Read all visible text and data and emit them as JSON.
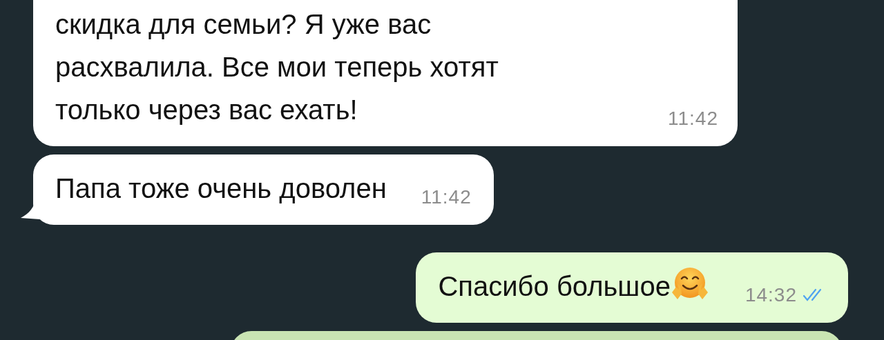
{
  "messages": [
    {
      "kind": "incoming",
      "text": "скидка для семьи? Я уже вас\nрасхвалила. Все мои теперь хотят\nтолько через вас ехать!",
      "time": "11:42",
      "tail": false,
      "cut_top": true
    },
    {
      "kind": "incoming",
      "text": "Папа тоже очень доволен",
      "time": "11:42",
      "tail": true,
      "cut_top": false
    },
    {
      "kind": "outgoing",
      "text": "Спасибо большое",
      "emoji": true,
      "time": "14:32",
      "read": true,
      "tail": false,
      "cut_top": false
    },
    {
      "kind": "outgoing"
    }
  ]
}
